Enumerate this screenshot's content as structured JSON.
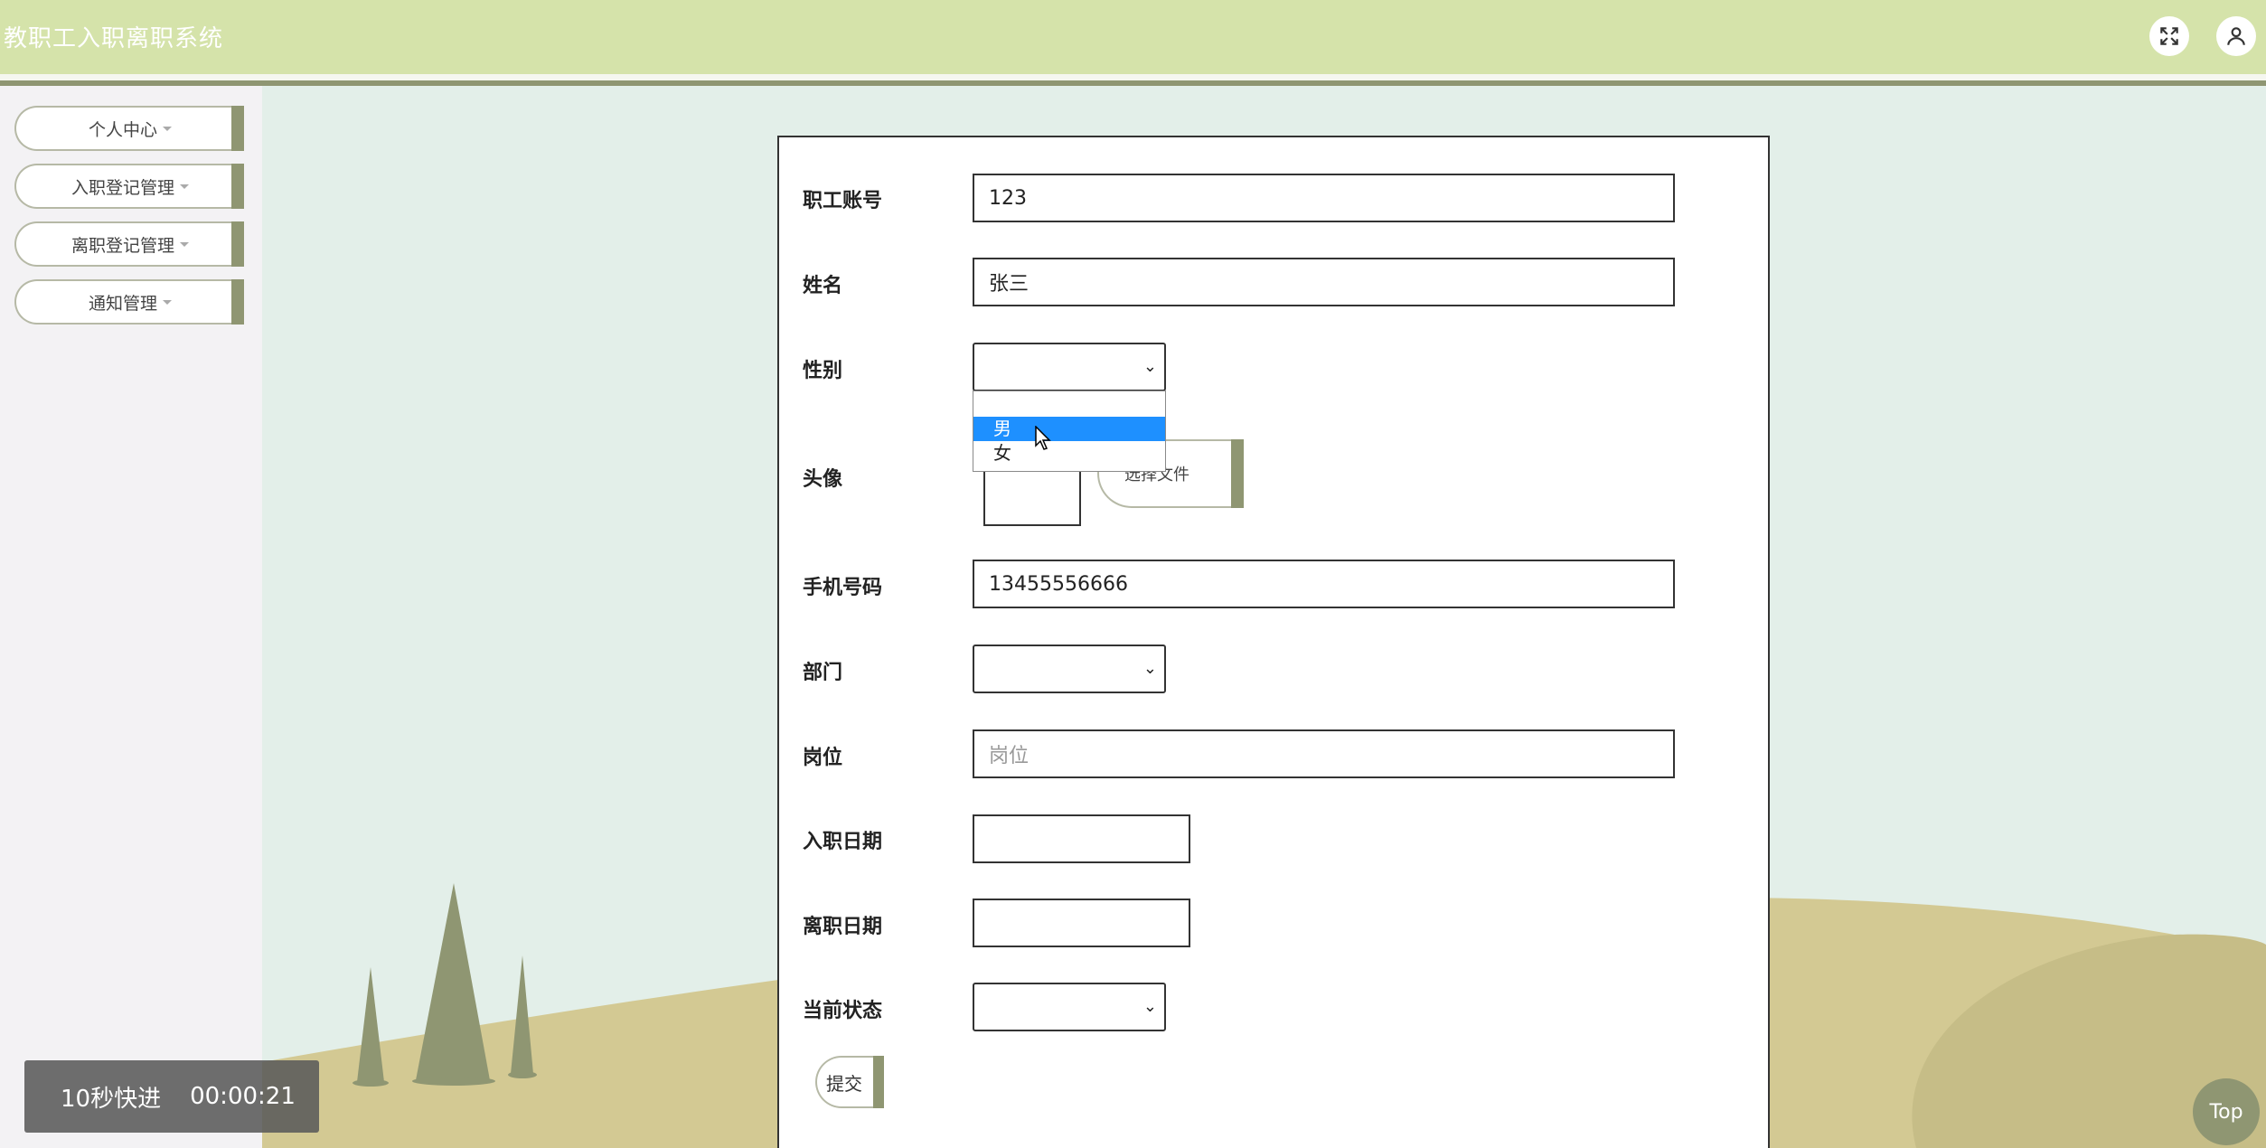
{
  "app": {
    "title": "教职工入职离职系统"
  },
  "header": {
    "fullscreen_icon": "fullscreen-icon",
    "user_icon": "user-icon"
  },
  "sidebar": {
    "items": [
      {
        "label": "个人中心"
      },
      {
        "label": "入职登记管理"
      },
      {
        "label": "离职登记管理"
      },
      {
        "label": "通知管理"
      }
    ]
  },
  "form": {
    "account": {
      "label": "职工账号",
      "value": "123"
    },
    "name": {
      "label": "姓名",
      "value": "张三"
    },
    "gender": {
      "label": "性别",
      "value": "",
      "options": [
        "",
        "男",
        "女"
      ],
      "highlighted": "男"
    },
    "avatar": {
      "label": "头像",
      "button": "选择文件"
    },
    "phone": {
      "label": "手机号码",
      "value": "13455556666"
    },
    "department": {
      "label": "部门",
      "value": ""
    },
    "position": {
      "label": "岗位",
      "placeholder": "岗位"
    },
    "hire_date": {
      "label": "入职日期",
      "value": ""
    },
    "leave_date": {
      "label": "离职日期",
      "value": ""
    },
    "status": {
      "label": "当前状态",
      "value": ""
    },
    "submit": "提交"
  },
  "overlay": {
    "speed": "10秒快进",
    "time": "00:00:21"
  },
  "top_button": "Top",
  "colors": {
    "header": "#d5e3aa",
    "accent": "#8f9672",
    "background": "#e3efe9",
    "selection": "#1e90ff"
  }
}
